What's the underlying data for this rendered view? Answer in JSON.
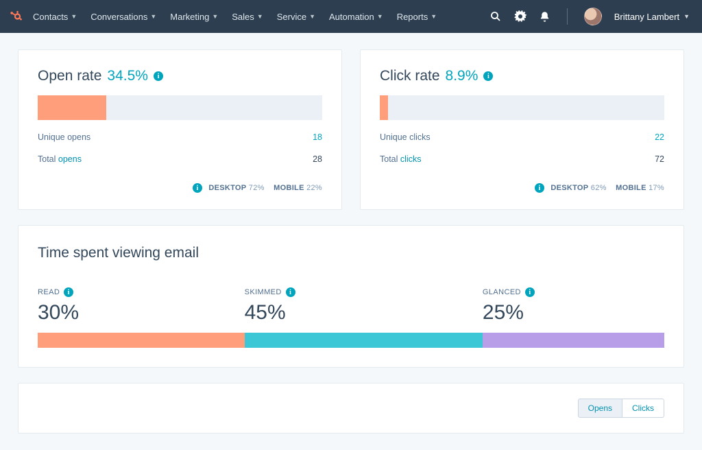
{
  "nav": {
    "items": [
      "Contacts",
      "Conversations",
      "Marketing",
      "Sales",
      "Service",
      "Automation",
      "Reports"
    ],
    "username": "Brittany Lambert"
  },
  "open_rate": {
    "title": "Open rate",
    "pct": "34.5%",
    "bar_fill_pct": 24,
    "unique_label": "Unique opens",
    "unique_val": "18",
    "total_label": "Total",
    "total_link": "opens",
    "total_val": "28",
    "desktop_label": "DESKTOP",
    "desktop_pct": "72%",
    "mobile_label": "MOBILE",
    "mobile_pct": "22%"
  },
  "click_rate": {
    "title": "Click rate",
    "pct": "8.9%",
    "bar_fill_pct": 3,
    "unique_label": "Unique clicks",
    "unique_val": "22",
    "total_label": "Total",
    "total_link": "clicks",
    "total_val": "72",
    "desktop_label": "DESKTOP",
    "desktop_pct": "62%",
    "mobile_label": "MOBILE",
    "mobile_pct": "17%"
  },
  "time_spent": {
    "title": "Time spent viewing email",
    "read_label": "READ",
    "read_pct": "30%",
    "skim_label": "SKIMMED",
    "skim_pct": "45%",
    "glance_label": "GLANCED",
    "glance_pct": "25%"
  },
  "bottom": {
    "opens_btn": "Opens",
    "clicks_btn": "Clicks"
  },
  "chart_data": [
    {
      "type": "bar",
      "title": "Open rate",
      "ylim": [
        0,
        100
      ],
      "categories": [
        "Open rate"
      ],
      "values": [
        34.5
      ],
      "annotations": {
        "unique_opens": 18,
        "total_opens": 28,
        "desktop_pct": 72,
        "mobile_pct": 22
      }
    },
    {
      "type": "bar",
      "title": "Click rate",
      "ylim": [
        0,
        100
      ],
      "categories": [
        "Click rate"
      ],
      "values": [
        8.9
      ],
      "annotations": {
        "unique_clicks": 22,
        "total_clicks": 72,
        "desktop_pct": 62,
        "mobile_pct": 17
      }
    },
    {
      "type": "bar",
      "title": "Time spent viewing email",
      "categories": [
        "READ",
        "SKIMMED",
        "GLANCED"
      ],
      "values": [
        30,
        45,
        25
      ],
      "ylim": [
        0,
        100
      ]
    }
  ]
}
